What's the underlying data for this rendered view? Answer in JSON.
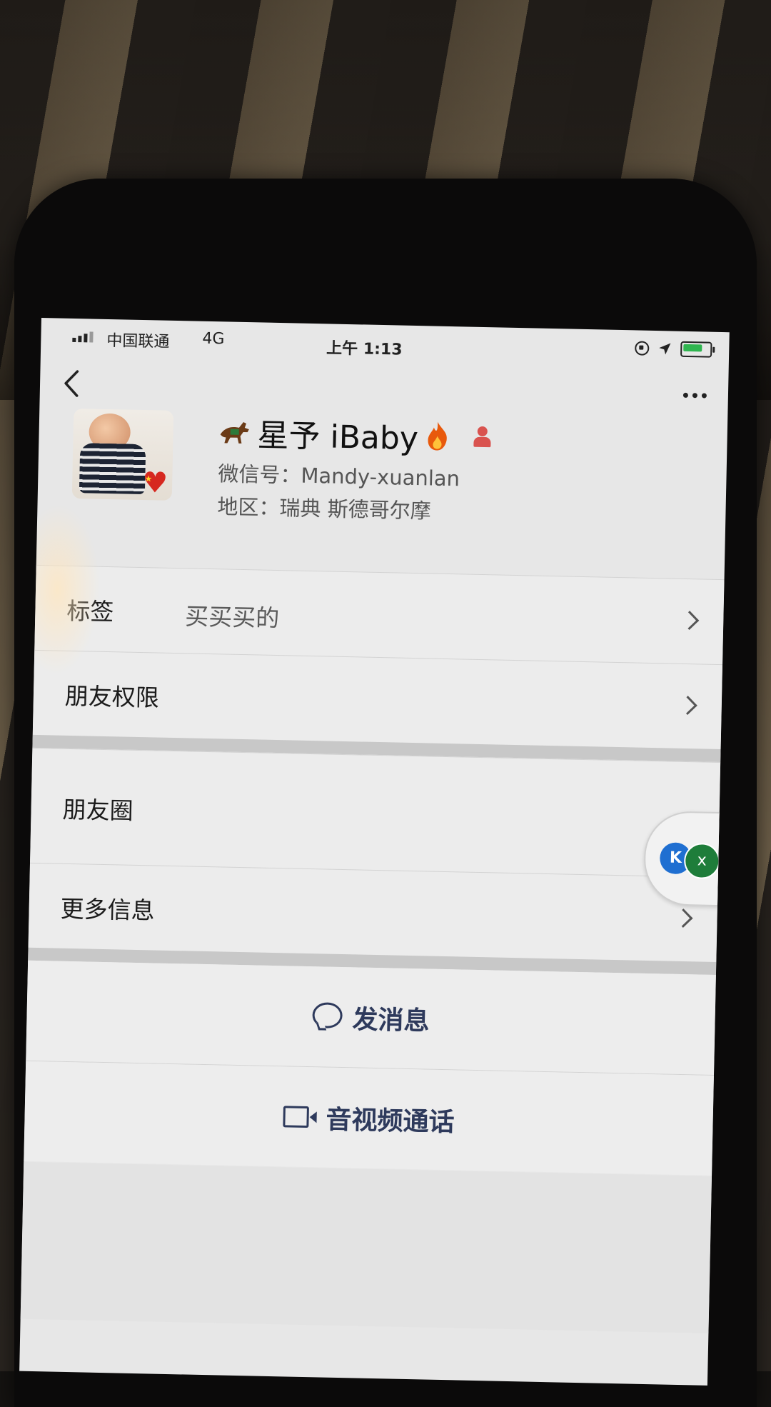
{
  "status_bar": {
    "carrier": "中国联通",
    "network": "4G",
    "time": "上午 1:13"
  },
  "nav": {
    "back_icon": "chevron-left-icon",
    "more_icon": "ellipsis-icon"
  },
  "profile": {
    "name": "星予 iBaby",
    "wechat_id": "微信号：Mandy-xuanlan",
    "region": "地区：瑞典 斯德哥尔摩",
    "name_prefix_icon": "horse-emoji",
    "name_suffix_icon": "fire-emoji",
    "badge_icon": "person-icon"
  },
  "cells": {
    "tags_label": "标签",
    "tags_value": "买买买的",
    "permissions_label": "朋友权限",
    "moments_label": "朋友圈",
    "more_info_label": "更多信息"
  },
  "float_ball": {
    "icon_left": "K",
    "icon_right": "x"
  },
  "actions": {
    "send_message": "发消息",
    "video_call": "音视频通话"
  },
  "colors": {
    "action_text": "#2e3a5c",
    "battery_green": "#2fb54f",
    "badge_red": "#d9534f"
  }
}
